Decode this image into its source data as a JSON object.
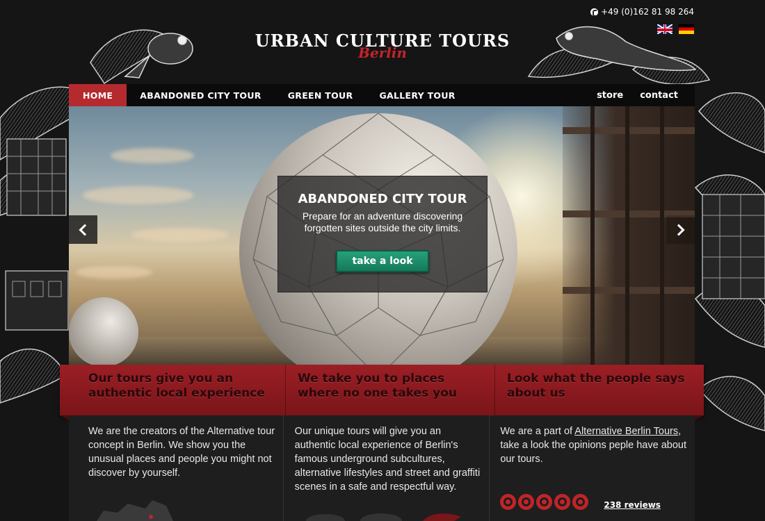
{
  "header": {
    "phone": "+49 (0)162 81 98 264",
    "logo_main": "URBAN CULTURE TOURS",
    "logo_sub": "Berlin",
    "languages": [
      "English",
      "Deutsch"
    ]
  },
  "nav": {
    "items": [
      {
        "label": "HOME",
        "active": true
      },
      {
        "label": "ABANDONED CITY TOUR",
        "active": false
      },
      {
        "label": "GREEN TOUR",
        "active": false
      },
      {
        "label": "GALLERY TOUR",
        "active": false
      }
    ],
    "right": [
      {
        "label": "store"
      },
      {
        "label": "contact"
      }
    ]
  },
  "hero": {
    "title": "ABANDONED CITY TOUR",
    "text": "Prepare for an adventure discovering forgotten sites outside the city limits.",
    "button": "take a look",
    "prev_icon": "chevron-left-icon",
    "next_icon": "chevron-right-icon"
  },
  "features": [
    {
      "heading": "Our tours give you an authentic local experience",
      "text": "We are the creators of the Alternative tour concept in Berlin. We show you the unusual places and people you might not discover by yourself."
    },
    {
      "heading": "We take you to places where no one takes you",
      "text": "Our unique tours will give you an authentic local experience of Berlin's famous underground subcultures, alternative lifestyles and street and graffiti scenes in a safe and respectful way."
    },
    {
      "heading": "Look what the people says about us",
      "text_before": "We are a part of ",
      "link": "Alternative Berlin Tours",
      "text_after": ", take a look the opinions peple have about our tours.",
      "rating": 5,
      "reviews": "238 reviews"
    }
  ],
  "colors": {
    "accent_red": "#b52a2e",
    "button_green": "#1f8c69",
    "nav_bg": "#0b0b0b"
  }
}
